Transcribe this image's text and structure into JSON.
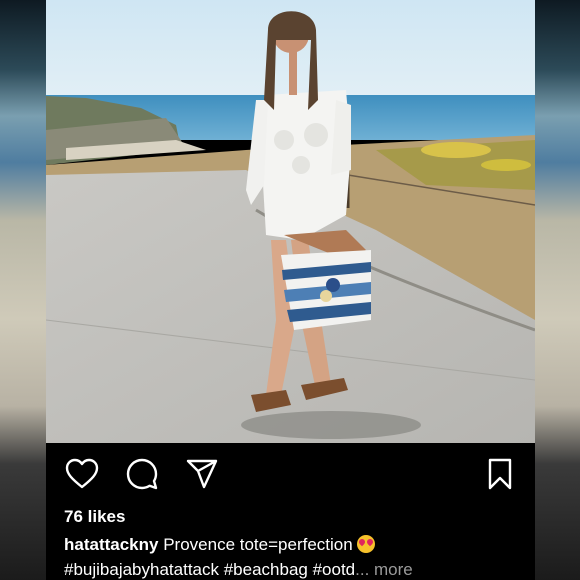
{
  "post": {
    "likes": "76 likes",
    "username": "hatattackny",
    "caption_text": " Provence tote=perfection",
    "emoji": "heart-eyes-emoji",
    "hashtags": "#bujibajabyhatattack #beachbag #ootd",
    "more_label": "... more"
  },
  "actions": {
    "like": "heart-icon",
    "comment": "comment-icon",
    "share": "send-icon",
    "save": "bookmark-icon"
  },
  "colors": {
    "background": "#000000",
    "text": "#ffffff",
    "muted": "#9a9a9a"
  }
}
